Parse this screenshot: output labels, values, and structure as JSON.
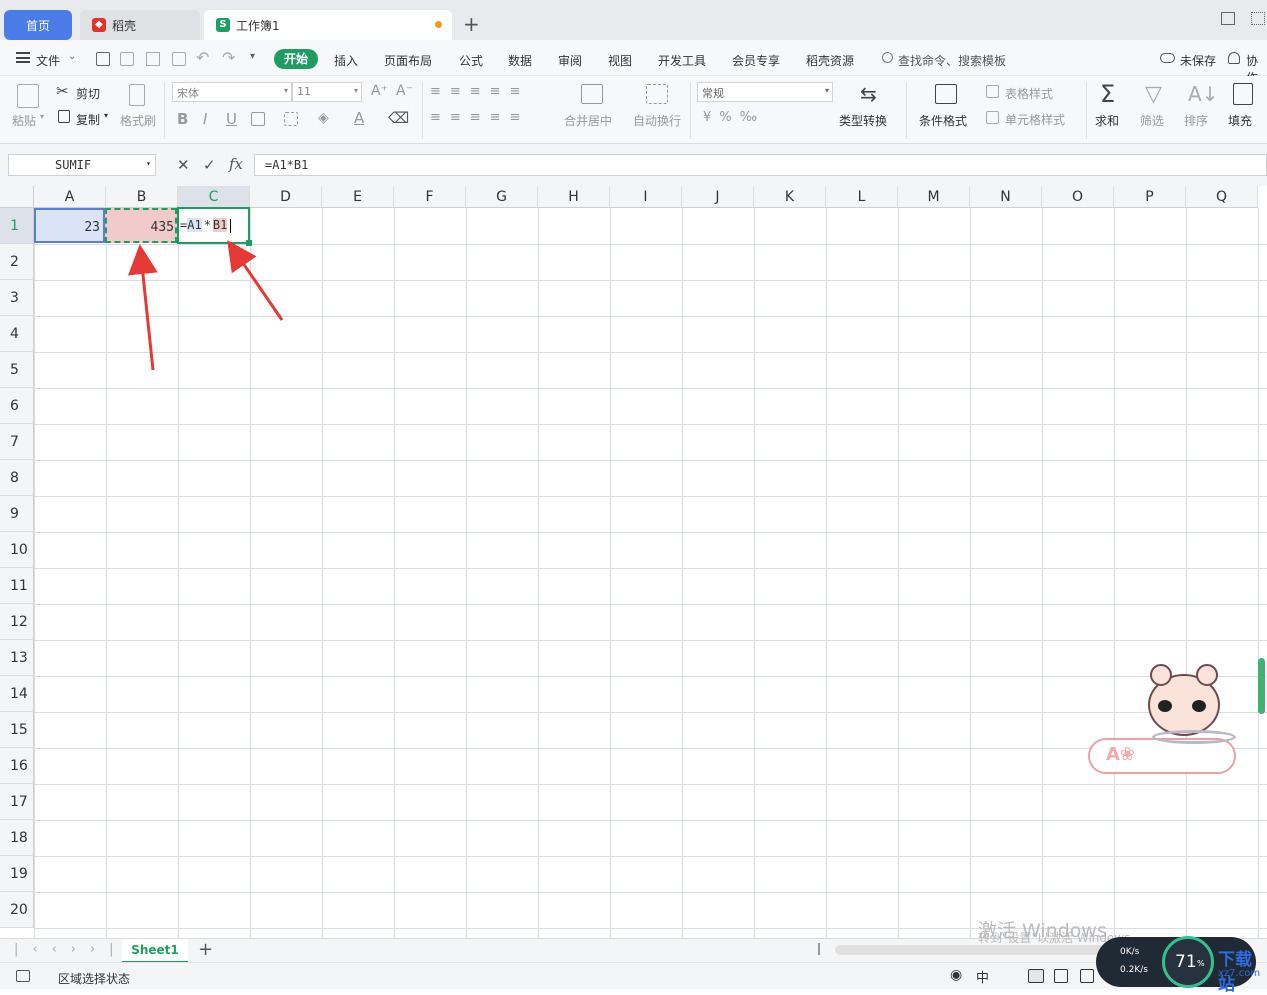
{
  "tabs": {
    "home": "首页",
    "daoke": "稻壳",
    "workbook": "工作簿1",
    "new_tab": "+"
  },
  "menu": {
    "file": "文件",
    "items": [
      "开始",
      "插入",
      "页面布局",
      "公式",
      "数据",
      "审阅",
      "视图",
      "开发工具",
      "会员专享",
      "稻壳资源"
    ],
    "search": "查找命令、搜索模板",
    "unsaved": "未保存",
    "collab": "协作"
  },
  "ribbon": {
    "paste": "粘贴",
    "cut": "剪切",
    "copy": "复制",
    "format_painter": "格式刷",
    "font_name": "宋体",
    "font_size": "11",
    "merge_center": "合并居中",
    "wrap_text": "自动换行",
    "number_format": "常规",
    "type_convert": "类型转换",
    "conditional_format": "条件格式",
    "table_style": "表格样式",
    "cell_style": "单元格样式",
    "sum": "求和",
    "filter": "筛选",
    "sort": "排序",
    "fill": "填充"
  },
  "formula_bar": {
    "name_box": "SUMIF",
    "fx": "fx",
    "formula": "=A1*B1"
  },
  "columns": [
    "A",
    "B",
    "C",
    "D",
    "E",
    "F",
    "G",
    "H",
    "I",
    "J",
    "K",
    "L",
    "M",
    "N",
    "O",
    "P",
    "Q"
  ],
  "rows": [
    "1",
    "2",
    "3",
    "4",
    "5",
    "6",
    "7",
    "8",
    "9",
    "10",
    "11",
    "12",
    "13",
    "14",
    "15",
    "16",
    "17",
    "18",
    "19",
    "20"
  ],
  "cells": {
    "A1": "23",
    "B1": "435",
    "C1_parts": [
      "=",
      "A1",
      "*",
      "B1"
    ]
  },
  "colors": {
    "accent": "#1e9d63",
    "tab_active": "#4a7ce8",
    "ref_a": "#dbe3f7",
    "ref_b": "#f1caca",
    "arrow": "#e53935"
  },
  "sheet": {
    "name": "Sheet1",
    "add": "+"
  },
  "status": {
    "mode": "区域选择状态",
    "zoom_percent": "71",
    "zoom_sign": "%",
    "up_speed": "0K/s",
    "down_speed": "0.2K/s"
  },
  "watermark": {
    "line1": "激活 Windows",
    "line2": "转到\"设置\"以激活 Windows。",
    "site": "下载站",
    "site_url": "xz7.com"
  }
}
